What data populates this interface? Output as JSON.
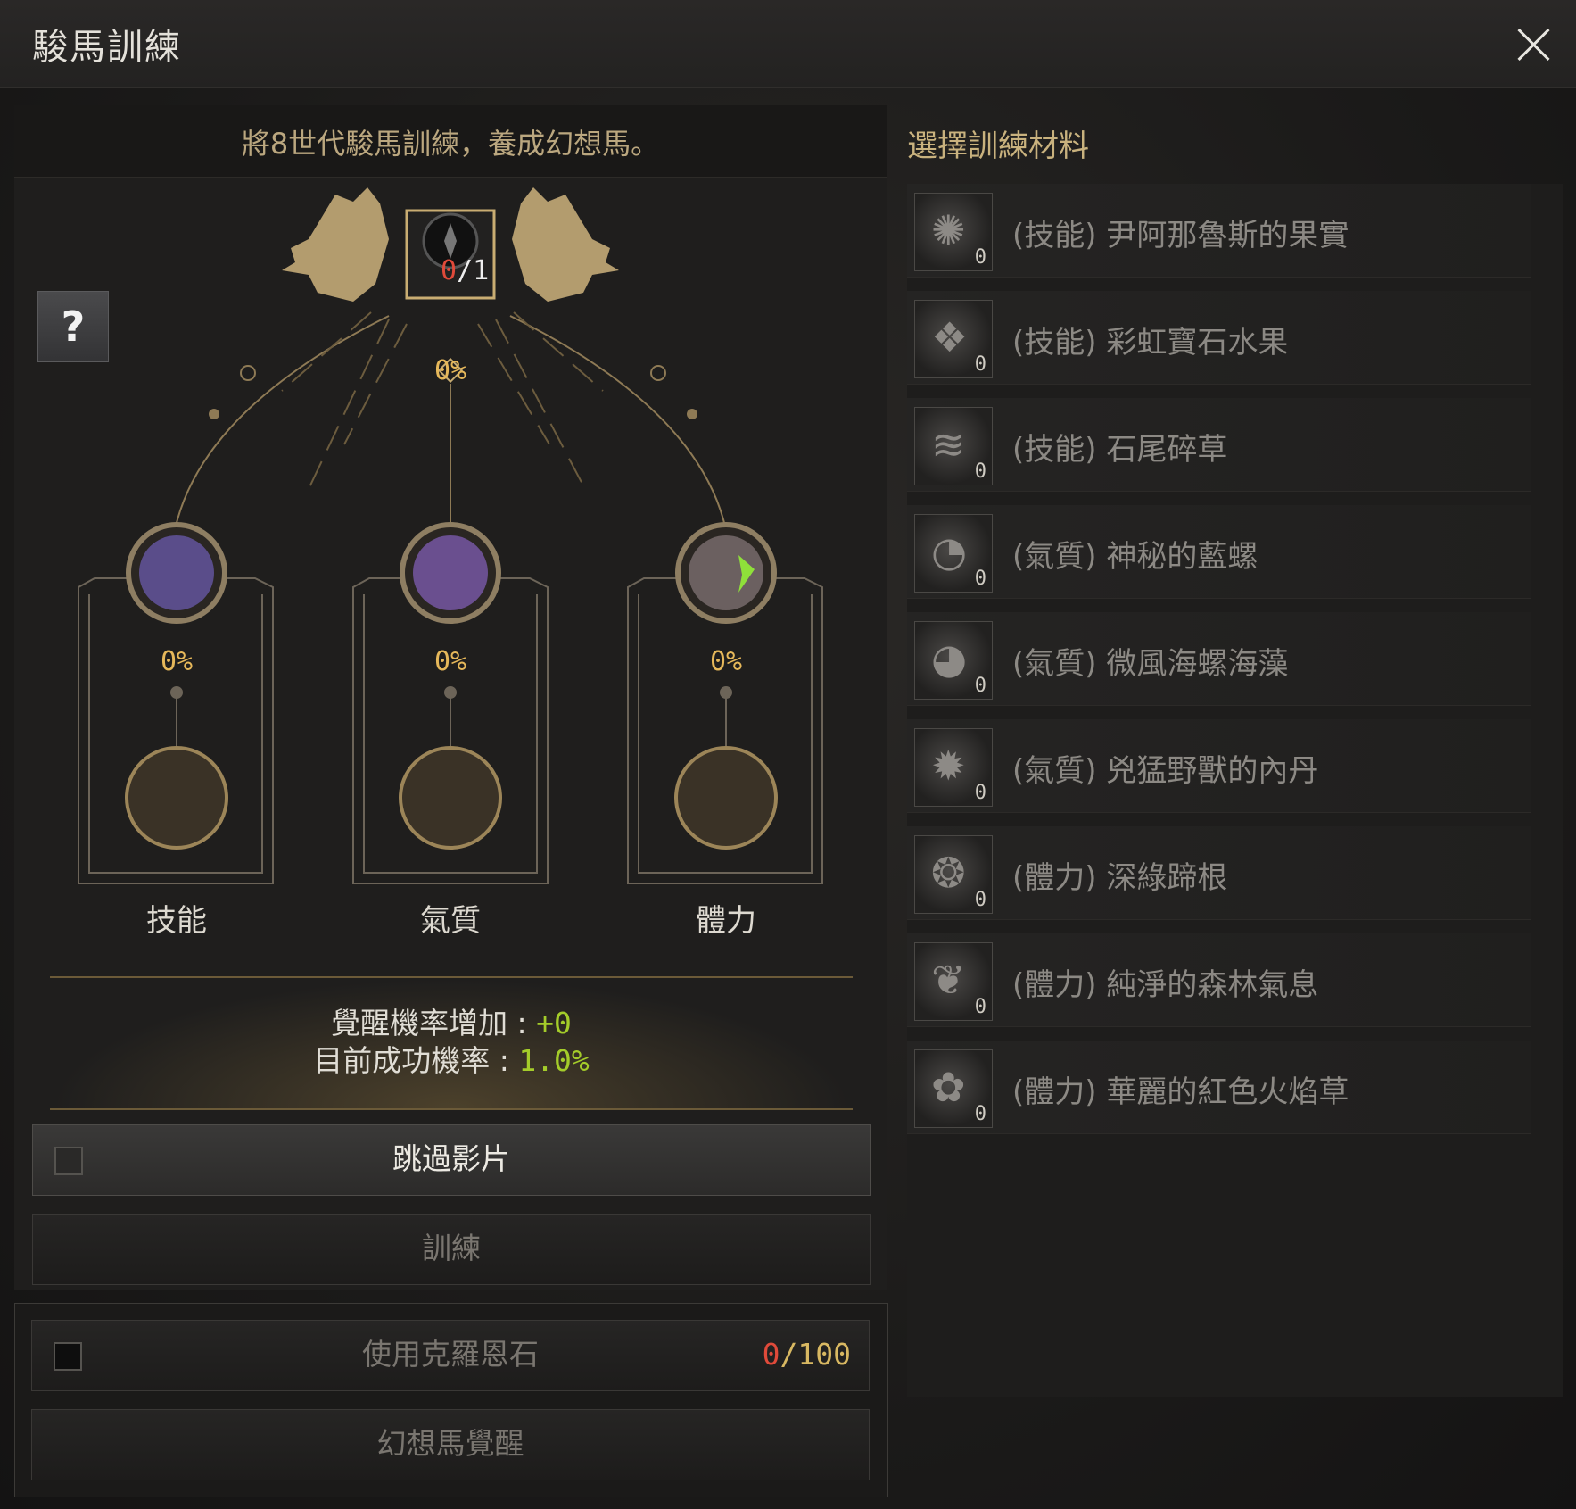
{
  "window": {
    "title": "駿馬訓練"
  },
  "left": {
    "subtitle": "將8世代駿馬訓練，養成幻想馬。",
    "help_label": "?",
    "center_slot": {
      "current": "0",
      "separator": "/",
      "required": "1",
      "percent": "0%"
    },
    "stats": [
      {
        "label": "技能",
        "percent": "0%"
      },
      {
        "label": "氣質",
        "percent": "0%"
      },
      {
        "label": "體力",
        "percent": "0%"
      }
    ],
    "info": {
      "awaken_label": "覺醒機率增加 : ",
      "awaken_value": "+0",
      "success_label": "目前成功機率 : ",
      "success_value": "1.0%"
    },
    "skip_video_label": "跳過影片",
    "train_label": "訓練",
    "crystone": {
      "label": "使用克羅恩石",
      "current": "0",
      "separator": "/",
      "max": "100"
    },
    "awaken_button_label": "幻想馬覺醒"
  },
  "right": {
    "title": "選擇訓練材料",
    "materials": [
      {
        "name": "(技能) 尹阿那魯斯的果實",
        "qty": "0",
        "icon": "fruit-icon"
      },
      {
        "name": "(技能) 彩虹寶石水果",
        "qty": "0",
        "icon": "gem-fruit-icon"
      },
      {
        "name": "(技能) 石尾碎草",
        "qty": "0",
        "icon": "herb-icon"
      },
      {
        "name": "(氣質) 神秘的藍螺",
        "qty": "0",
        "icon": "shell-icon"
      },
      {
        "name": "(氣質) 微風海螺海藻",
        "qty": "0",
        "icon": "conch-icon"
      },
      {
        "name": "(氣質) 兇猛野獸的內丹",
        "qty": "0",
        "icon": "core-icon"
      },
      {
        "name": "(體力) 深綠蹄根",
        "qty": "0",
        "icon": "root-icon"
      },
      {
        "name": "(體力) 純淨的森林氣息",
        "qty": "0",
        "icon": "leaf-icon"
      },
      {
        "name": "(體力) 華麗的紅色火焰草",
        "qty": "0",
        "icon": "flower-icon"
      }
    ]
  },
  "colors": {
    "accent_gold": "#e6b85a",
    "green": "#a4cc2a",
    "red": "#e04a3a"
  }
}
